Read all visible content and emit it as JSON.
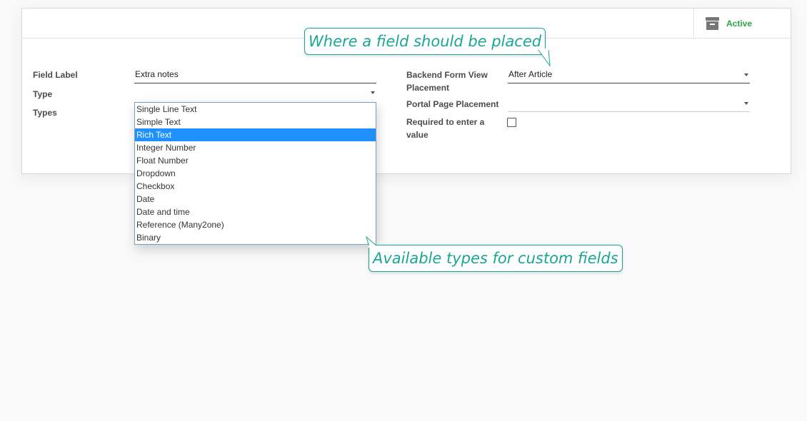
{
  "header": {
    "active_label": "Active",
    "icon": "archive-icon"
  },
  "form": {
    "field_label": {
      "label": "Field Label",
      "value": "Extra notes"
    },
    "type": {
      "label": "Type",
      "value": ""
    },
    "types": {
      "label": "Types"
    },
    "backend_placement": {
      "label_line1": "Backend Form View",
      "label_line2": "Placement",
      "value": "After Article"
    },
    "portal_placement": {
      "label": "Portal Page Placement",
      "value": ""
    },
    "required": {
      "label_line1": "Required to enter a",
      "label_line2": "value",
      "checked": false
    }
  },
  "dropdown": {
    "options": [
      {
        "label": "Single Line Text"
      },
      {
        "label": "Simple Text"
      },
      {
        "label": "Rich Text",
        "selected": true
      },
      {
        "label": "Integer Number"
      },
      {
        "label": "Float Number"
      },
      {
        "label": "Dropdown"
      },
      {
        "label": "Checkbox"
      },
      {
        "label": "Date"
      },
      {
        "label": "Date and time"
      },
      {
        "label": "Reference (Many2one)"
      },
      {
        "label": "Binary"
      }
    ]
  },
  "callouts": {
    "placement": "Where a field should be placed",
    "types": "Available types for custom fields"
  },
  "colors": {
    "accent": "#1aa595",
    "active": "#28a745",
    "selection": "#1e90ff"
  }
}
